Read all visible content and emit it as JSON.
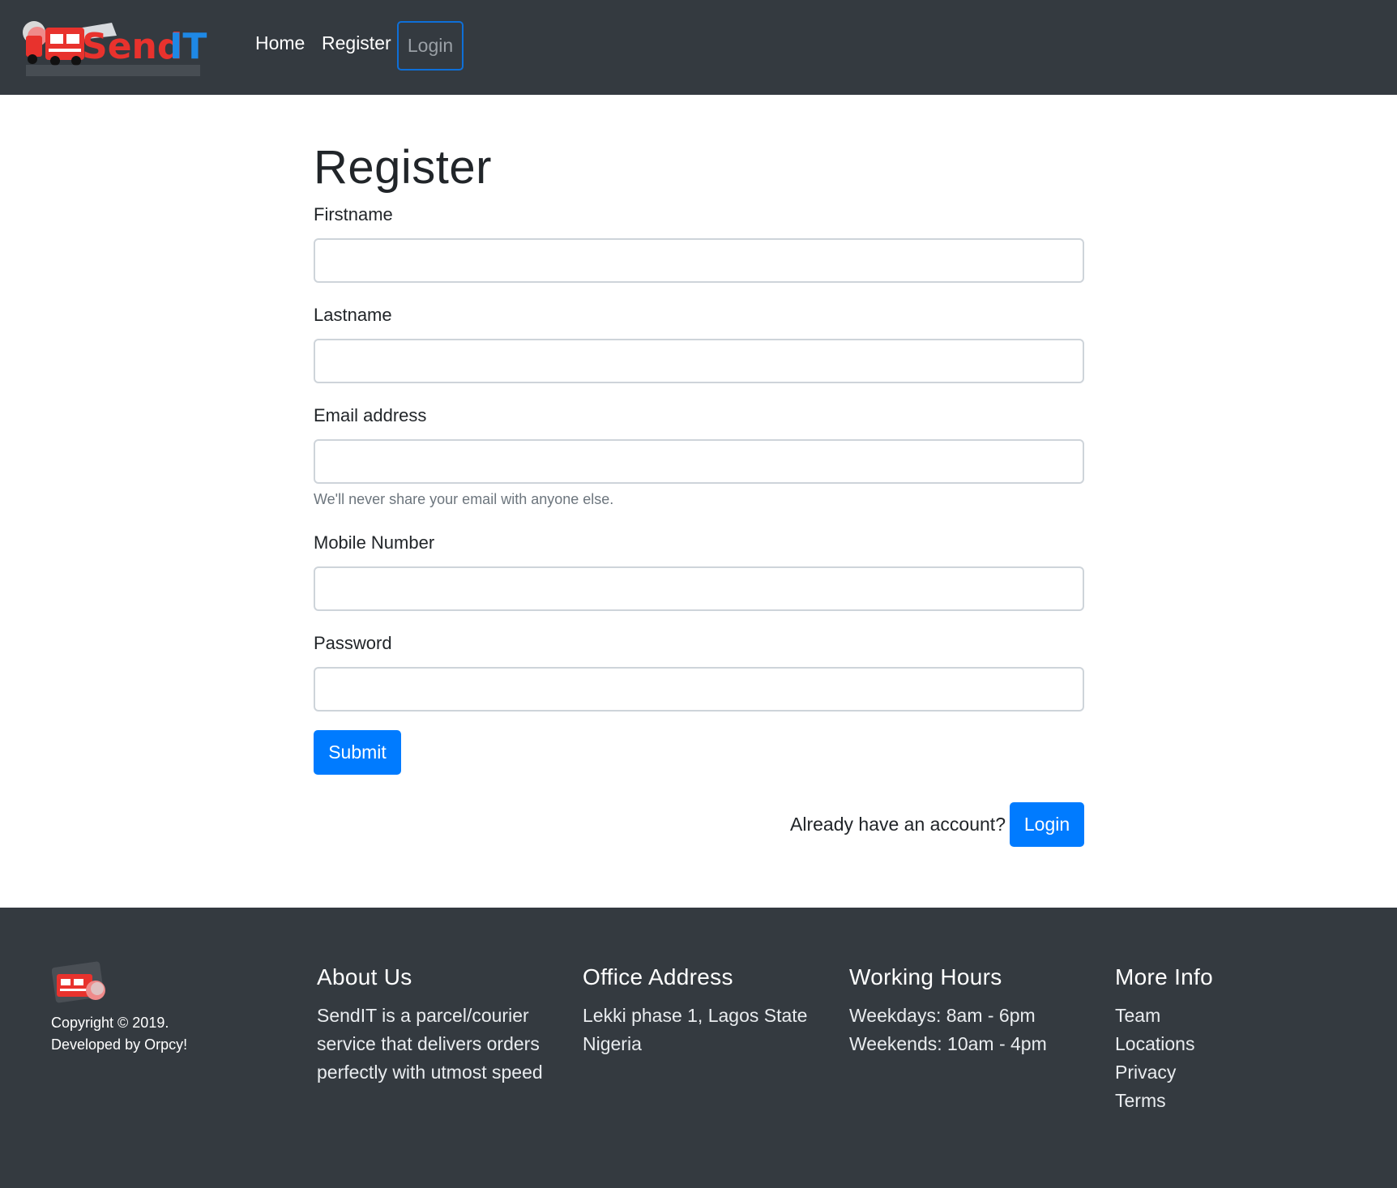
{
  "navbar": {
    "brand_text_left": "Send",
    "brand_text_right": "IT",
    "links": {
      "home": "Home",
      "register": "Register",
      "login": "Login"
    }
  },
  "form": {
    "title": "Register",
    "firstname_label": "Firstname",
    "lastname_label": "Lastname",
    "email_label": "Email address",
    "email_help": "We'll never share your email with anyone else.",
    "mobile_label": "Mobile Number",
    "password_label": "Password",
    "submit_label": "Submit",
    "already_text": "Already have an account?",
    "login_label": "Login"
  },
  "footer": {
    "copyright_line1": "Copyright © 2019.",
    "copyright_line2": "Developed by Orpcy!",
    "about": {
      "heading": "About Us",
      "text": "SendIT is a parcel/courier service that delivers orders perfectly with utmost speed"
    },
    "office": {
      "heading": "Office Address",
      "line1": "Lekki phase 1, Lagos State",
      "line2": "Nigeria"
    },
    "hours": {
      "heading": "Working Hours",
      "weekdays": "Weekdays: 8am - 6pm",
      "weekends": "Weekends: 10am - 4pm"
    },
    "more": {
      "heading": "More Info",
      "links": [
        "Team",
        "Locations",
        "Privacy",
        "Terms"
      ]
    }
  },
  "colors": {
    "navbar_bg": "#343a40",
    "primary": "#007bff",
    "brand_red": "#e8322d",
    "brand_blue": "#1e88e5",
    "muted": "#6c757d"
  },
  "icons": {
    "brand_logo": "delivery-truck-logo",
    "footer_logo": "delivery-truck-icon"
  }
}
